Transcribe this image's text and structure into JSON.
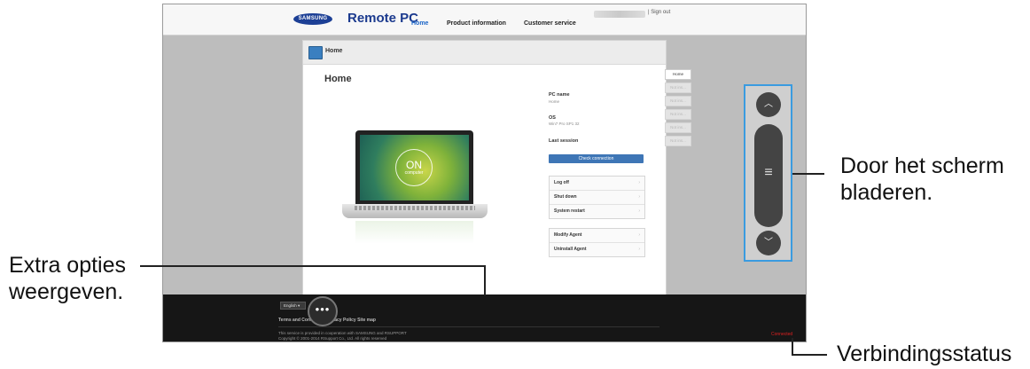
{
  "app": {
    "logo": "SAMSUNG",
    "brand": "Remote PC",
    "nav": [
      "Home",
      "Product information",
      "Customer service"
    ],
    "sign_out": "| Sign out"
  },
  "panel": {
    "header_title": "Home",
    "title": "Home",
    "laptop_status": "ON",
    "laptop_sub": "computer",
    "pc_name_label": "PC name",
    "pc_name_value": "Home",
    "os_label": "OS",
    "os_value": "Win7 Pro SP1 32",
    "last_session_label": "Last session",
    "check_button": "Check connection",
    "actions_group1": [
      "Log off",
      "Shut down",
      "System restart"
    ],
    "actions_group2": [
      "Modify Agent",
      "Uninstall Agent"
    ],
    "chevron": "›"
  },
  "side_tabs": [
    "Home",
    "Not ins...",
    "Not ins...",
    "Not ins...",
    "Not ins...",
    "Not ins..."
  ],
  "footer": {
    "language": "English",
    "links": "Terms and Conditions  Privacy Policy  Site map",
    "copy_line1": "This service is provided in cooperation with SAMSUNG and RSUPPORT",
    "copy_line2": "Copyright © 2001-2014 RSupport Co., Ltd. All rights reserved",
    "status": "Connected"
  },
  "menu_button": "•••",
  "scroll": {
    "up": "︿",
    "down": "﹀",
    "grip": "≡"
  },
  "callouts": {
    "scroll": [
      "Door het scherm",
      "bladeren."
    ],
    "options": [
      "Extra opties",
      "weergeven."
    ],
    "status": "Verbindingsstatus"
  },
  "colors": {
    "accent": "#3a9be0",
    "status": "#e02020",
    "brand": "#1b3a8e"
  }
}
